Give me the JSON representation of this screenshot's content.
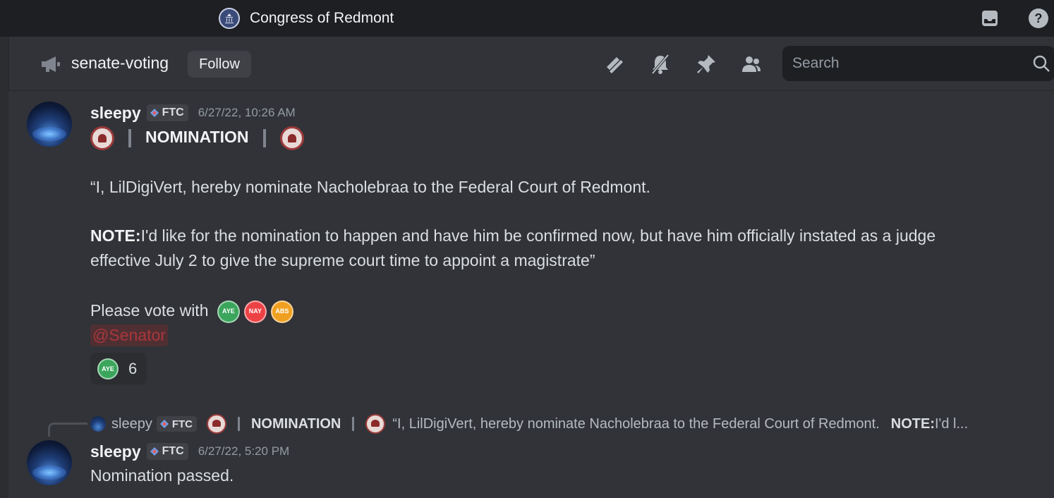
{
  "titlebar": {
    "server_name": "Congress of Redmont",
    "icons": [
      "inbox-icon",
      "help-icon"
    ]
  },
  "channel": {
    "name": "senate-voting",
    "follow_label": "Follow",
    "header_icons": [
      "threads-icon",
      "mute-icon",
      "pin-icon",
      "members-icon"
    ],
    "search_placeholder": "Search"
  },
  "messages": [
    {
      "username": "sleepy",
      "tag": "FTC",
      "timestamp": "6/27/22, 10:26 AM",
      "title": "NOMINATION",
      "quote": "“I, LilDigiVert, hereby nominate Nacholebraa to the Federal Court of Redmont.",
      "note_label": "NOTE:",
      "note_line1": "I'd like for the nomination to happen and have him be confirmed now, but have him officially instated as a judge",
      "note_line2": "effective July 2 to give the supreme court time to appoint a magistrate”",
      "vote_prompt": "Please vote with",
      "vote_options": [
        {
          "label": "AYE",
          "color": "#3ba55c"
        },
        {
          "label": "NAY",
          "color": "#ed4245"
        },
        {
          "label": "ABS",
          "color": "#f0a020"
        }
      ],
      "mention": "@Senator",
      "reaction": {
        "label": "AYE",
        "count": "6"
      }
    },
    {
      "reply": {
        "username": "sleepy",
        "tag": "FTC",
        "title": "NOMINATION",
        "text": "“I, LilDigiVert, hereby nominate Nacholebraa to the Federal Court of Redmont.",
        "note_label": "NOTE:",
        "note_snippet": "I'd l..."
      },
      "username": "sleepy",
      "tag": "FTC",
      "timestamp": "6/27/22, 5:20 PM",
      "text": "Nomination passed."
    }
  ],
  "colors": {
    "background": "#313338",
    "titlebar": "#1e1f22",
    "mention": "#a8373b"
  }
}
